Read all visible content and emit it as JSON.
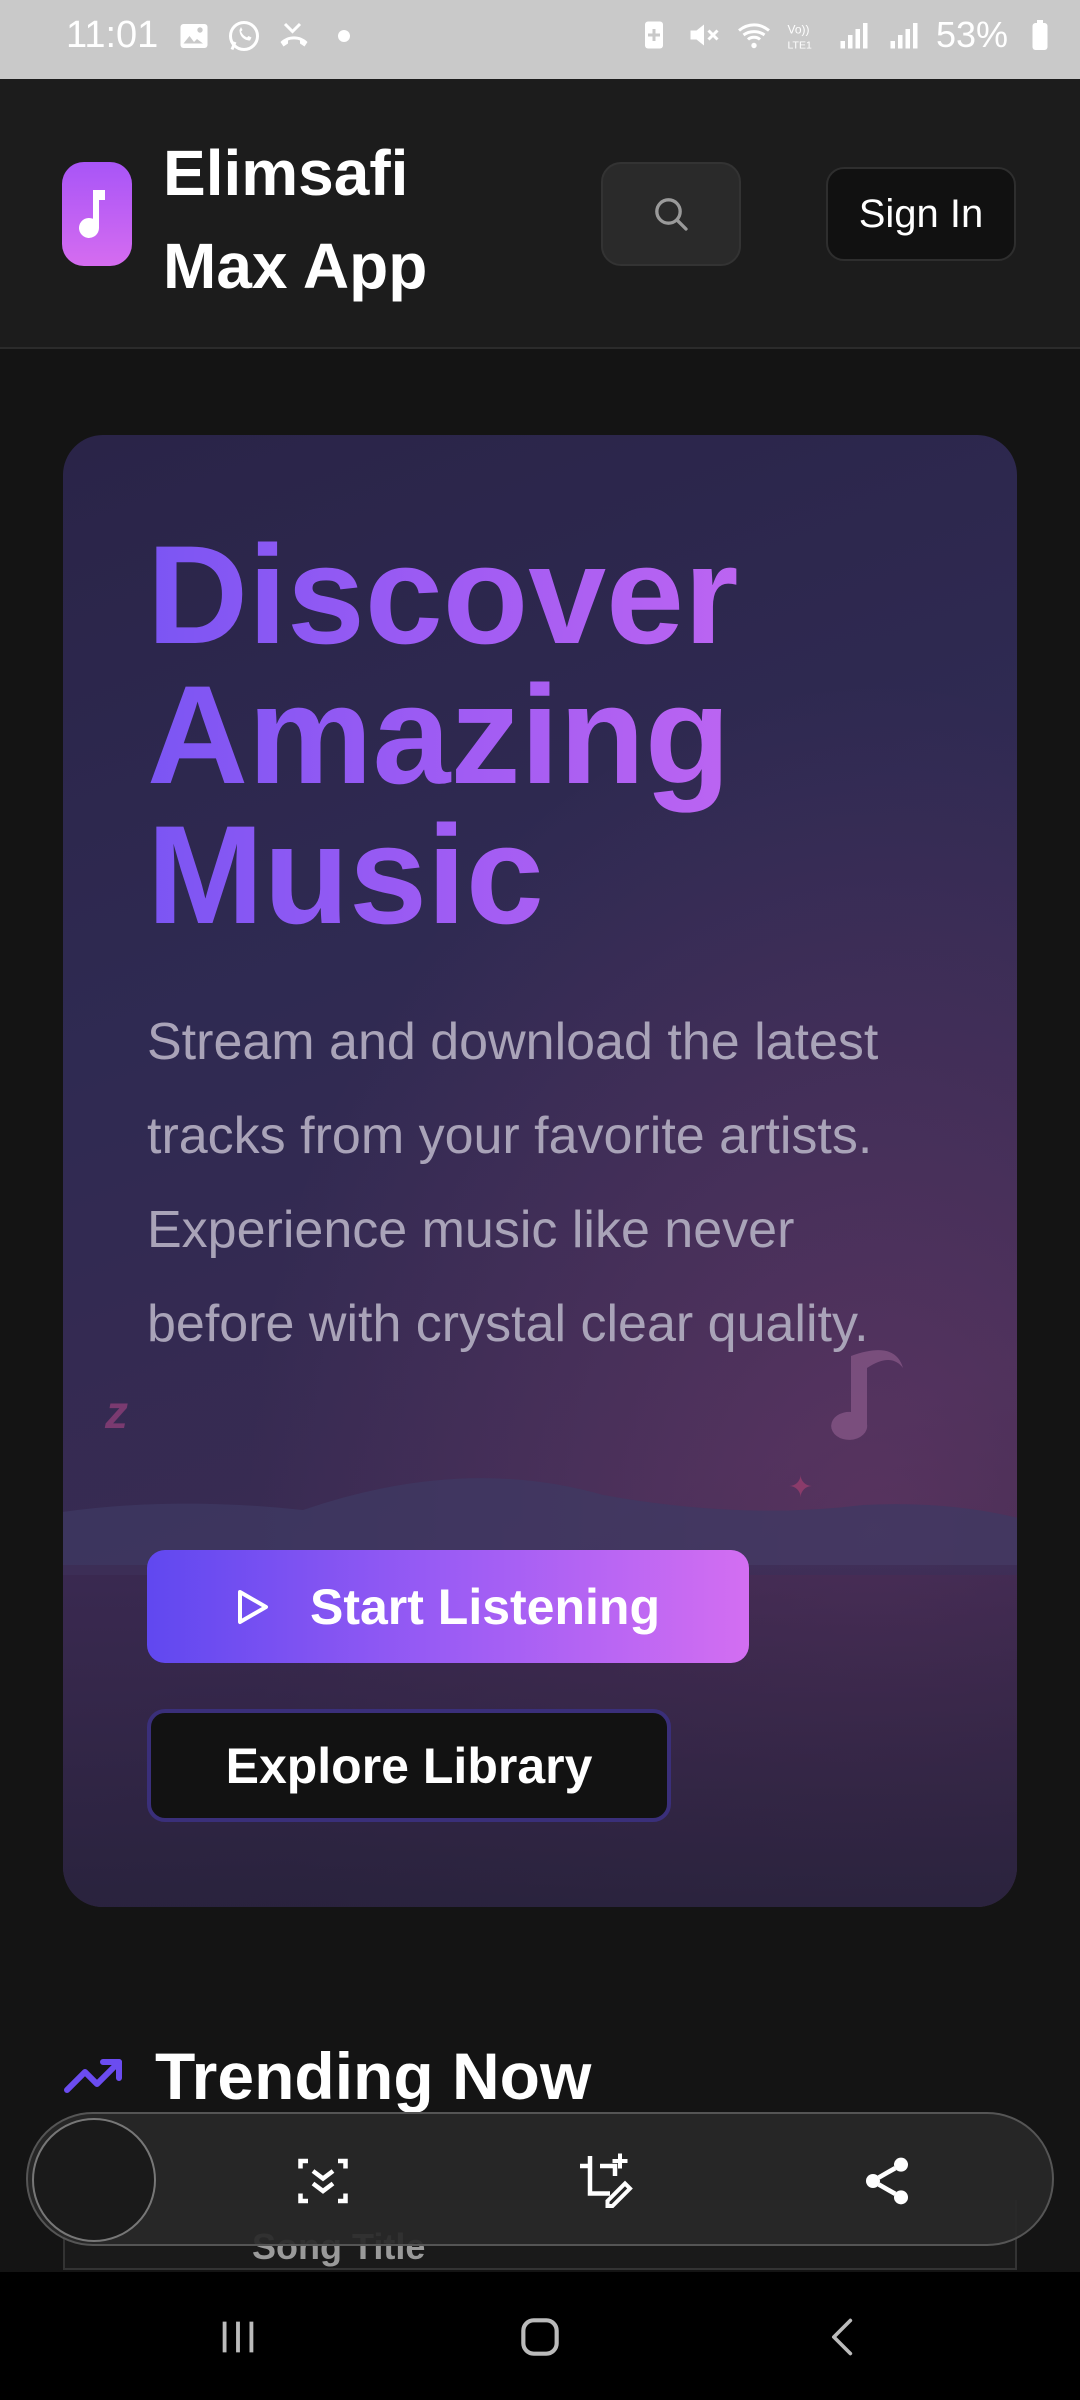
{
  "status_bar": {
    "time": "11:01",
    "battery": "53%",
    "left_icons": [
      "gallery-icon",
      "whatsapp-icon",
      "missed-call-icon",
      "dot-icon"
    ],
    "right_icons": [
      "battery-saver-icon",
      "mute-icon",
      "wifi-icon",
      "volte-icon",
      "signal-icon",
      "signal-icon",
      "battery-icon"
    ]
  },
  "header": {
    "app_name": "Elimsafi Max App",
    "logo_icon": "music-note-icon",
    "search_icon": "search-icon",
    "sign_in_label": "Sign In"
  },
  "hero": {
    "title": "Discover Amazing Music",
    "description": "Stream and download the latest tracks from your favorite artists. Experience music like never before with crystal clear quality.",
    "primary_button": "Start Listening",
    "secondary_button": "Explore Library"
  },
  "trending": {
    "title": "Trending Now",
    "icon": "trending-up-icon",
    "first_song_title": "Song Title"
  },
  "floating_toolbar": {
    "icons": [
      "scroll-capture-icon",
      "edit-crop-icon",
      "share-icon"
    ]
  },
  "nav": {
    "icons": [
      "recents-icon",
      "home-icon",
      "back-icon"
    ]
  },
  "colors": {
    "accent_start": "#6048f0",
    "accent_end": "#d36ef2",
    "background": "#141414"
  }
}
